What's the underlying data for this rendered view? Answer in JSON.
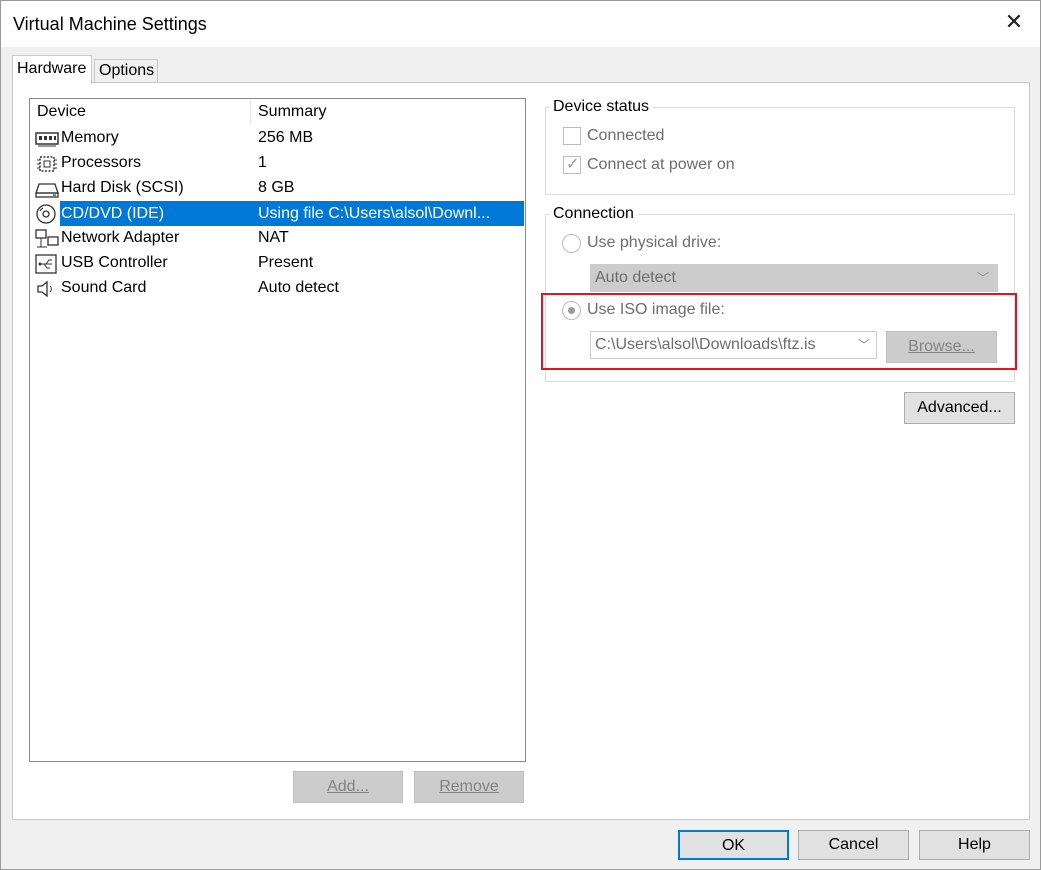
{
  "window": {
    "title": "Virtual Machine Settings",
    "close_icon": "close-icon"
  },
  "tabs": [
    {
      "label": "Hardware"
    },
    {
      "label": "Options"
    }
  ],
  "device_list": {
    "headers": {
      "device": "Device",
      "summary": "Summary"
    },
    "rows": [
      {
        "name": "Memory",
        "summary": "256 MB",
        "icon": "memory-icon"
      },
      {
        "name": "Processors",
        "summary": "1",
        "icon": "processor-icon"
      },
      {
        "name": "Hard Disk (SCSI)",
        "summary": "8 GB",
        "icon": "hard-disk-icon"
      },
      {
        "name": "CD/DVD (IDE)",
        "summary": "Using file C:\\Users\\alsol\\Downl...",
        "icon": "cd-dvd-icon",
        "selected": true
      },
      {
        "name": "Network Adapter",
        "summary": "NAT",
        "icon": "network-icon"
      },
      {
        "name": "USB Controller",
        "summary": "Present",
        "icon": "usb-icon"
      },
      {
        "name": "Sound Card",
        "summary": "Auto detect",
        "icon": "sound-icon"
      }
    ]
  },
  "list_buttons": {
    "add": "Add...",
    "remove": "Remove"
  },
  "device_status": {
    "label": "Device status",
    "connected": {
      "label": "Connected",
      "checked": false
    },
    "connect_at_power_on": {
      "label": "Connect at power on",
      "checked": true
    }
  },
  "connection": {
    "label": "Connection",
    "use_physical_drive": {
      "label": "Use physical drive:",
      "selected": false
    },
    "physical_drive_value": "Auto detect",
    "use_iso": {
      "label": "Use ISO image file:",
      "selected": true
    },
    "iso_path": "C:\\Users\\alsol\\Downloads\\ftz.is",
    "browse": "Browse..."
  },
  "advanced": "Advanced...",
  "footer": {
    "ok": "OK",
    "cancel": "Cancel",
    "help": "Help"
  },
  "colors": {
    "selection": "#0078d7",
    "highlight_border": "#e81123"
  }
}
